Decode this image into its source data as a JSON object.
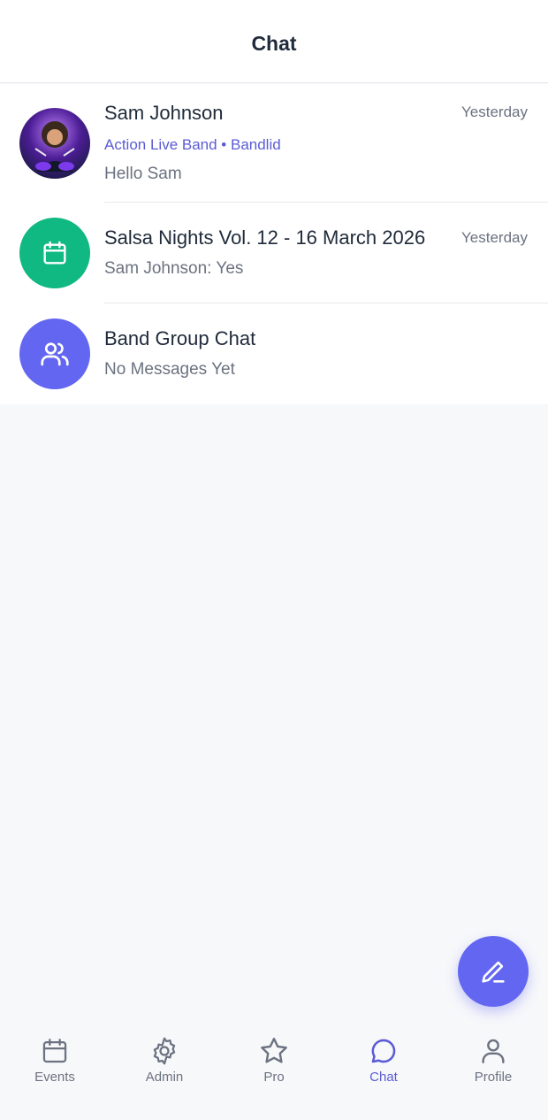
{
  "header": {
    "title": "Chat"
  },
  "chats": [
    {
      "title": "Sam Johnson",
      "subtitle": "Action Live Band • Bandlid",
      "message": "Hello Sam",
      "time": "Yesterday",
      "avatar": "user-photo"
    },
    {
      "title": "Salsa Nights Vol. 12 - 16 March 2026",
      "message": "Sam Johnson: Yes",
      "time": "Yesterday",
      "avatar": "calendar-icon",
      "avatar_color": "#10b981"
    },
    {
      "title": "Band Group Chat",
      "message": "No Messages Yet",
      "avatar": "users-icon",
      "avatar_color": "#6366f1"
    }
  ],
  "fab": {
    "icon": "pencil-icon",
    "color": "#6366f1"
  },
  "tabbar": {
    "tabs": [
      {
        "label": "Events",
        "icon": "calendar-icon",
        "active": false
      },
      {
        "label": "Admin",
        "icon": "gear-icon",
        "active": false
      },
      {
        "label": "Pro",
        "icon": "star-icon",
        "active": false
      },
      {
        "label": "Chat",
        "icon": "chat-bubble-icon",
        "active": true
      },
      {
        "label": "Profile",
        "icon": "person-icon",
        "active": false
      }
    ]
  },
  "colors": {
    "accent": "#5b5bd6",
    "muted": "#6b7280"
  }
}
